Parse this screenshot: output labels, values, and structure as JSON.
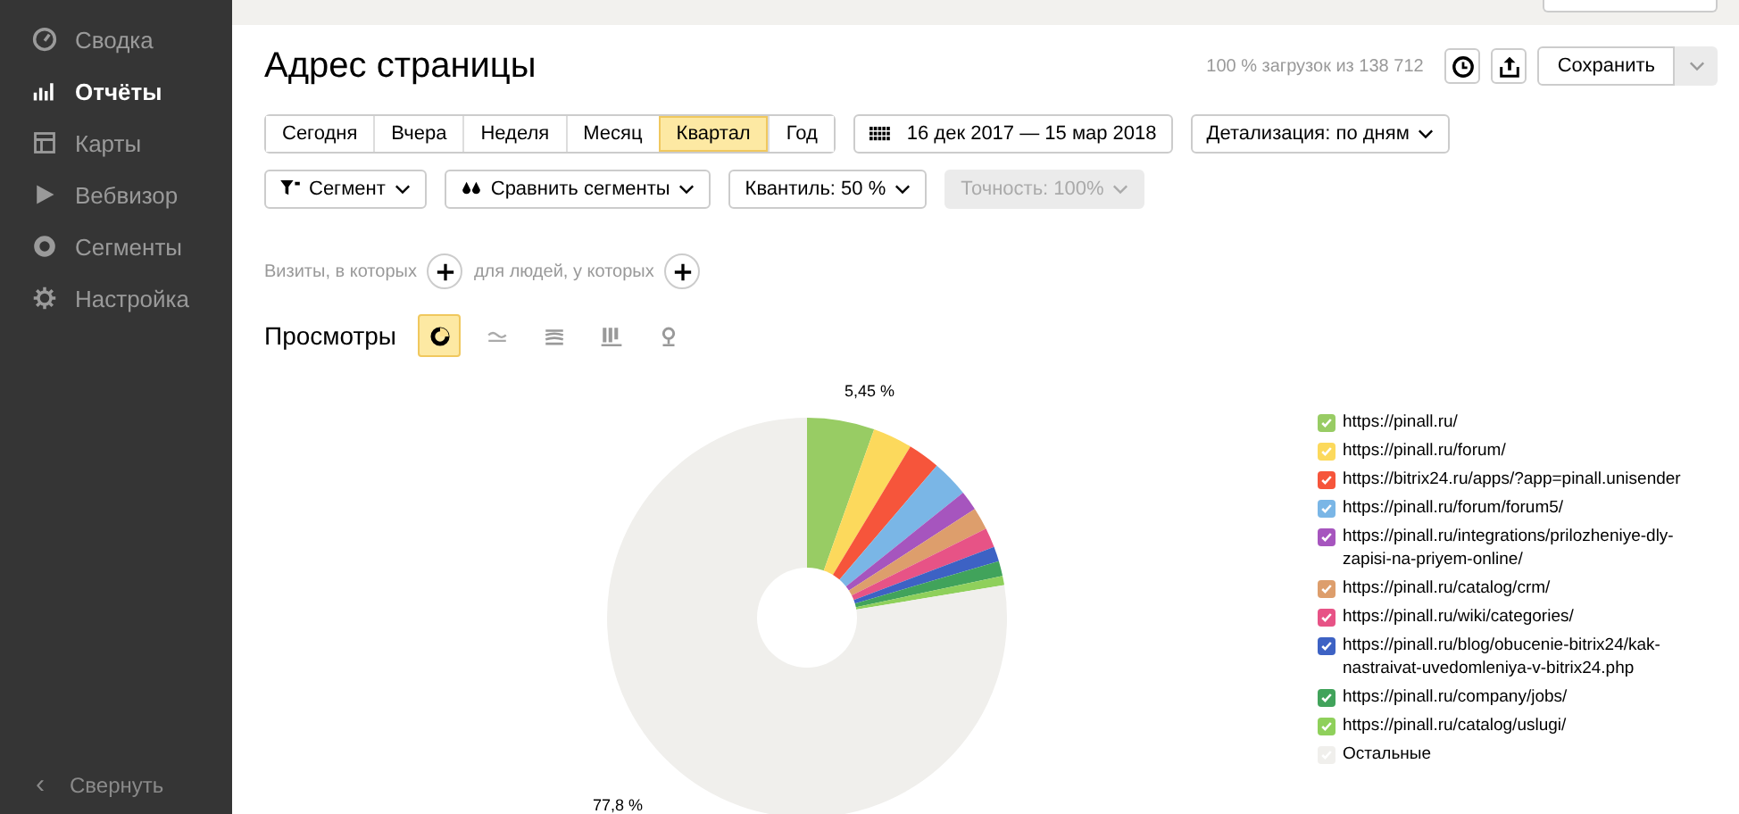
{
  "sidebar": {
    "items": [
      {
        "label": "Сводка",
        "selected": false
      },
      {
        "label": "Отчёты",
        "selected": true
      },
      {
        "label": "Карты",
        "selected": false
      },
      {
        "label": "Вебвизор",
        "selected": false
      },
      {
        "label": "Сегменты",
        "selected": false
      },
      {
        "label": "Настройка",
        "selected": false
      }
    ],
    "collapse": {
      "arrow": "‹",
      "label": "Свернуть"
    }
  },
  "header": {
    "title": "Адрес страницы",
    "load_info": "100 % загрузок из 138 712",
    "save_button": "Сохранить"
  },
  "periods": [
    {
      "label": "Сегодня",
      "selected": false
    },
    {
      "label": "Вчера",
      "selected": false
    },
    {
      "label": "Неделя",
      "selected": false
    },
    {
      "label": "Месяц",
      "selected": false
    },
    {
      "label": "Квартал",
      "selected": true
    },
    {
      "label": "Год",
      "selected": false
    }
  ],
  "date_range": "16 дек 2017 — 15 мар 2018",
  "detail": "Детализация: по дням",
  "filters": [
    {
      "label": "Сегмент",
      "disabled": false
    },
    {
      "label": "Сравнить сегменты",
      "disabled": false
    },
    {
      "label": "Квантиль: 50 %",
      "disabled": false
    },
    {
      "label": "Точность: 100%",
      "disabled": true
    }
  ],
  "conditions": {
    "visits": "Визиты, в которых",
    "people": "для людей, у которых"
  },
  "metric": {
    "label": "Просмотры",
    "chart_types": [
      {
        "selected": true
      },
      {
        "selected": false
      },
      {
        "selected": false
      },
      {
        "selected": false
      },
      {
        "selected": false
      }
    ]
  },
  "chart": {
    "top_label": "5,45 %",
    "bottom_label": "77,8 %"
  },
  "legend": [
    {
      "label": "https://pinall.ru/",
      "color": "#98cc64",
      "checked": true
    },
    {
      "label": "https://pinall.ru/forum/",
      "color": "#fcd95c",
      "checked": true
    },
    {
      "label": "https://bitrix24.ru/apps/?app=pinall.unisender",
      "color": "#f6553b",
      "checked": true
    },
    {
      "label": "https://pinall.ru/forum/forum5/",
      "color": "#7ab6e6",
      "checked": true
    },
    {
      "label": "https://pinall.ru/integrations/prilozheniye-dly-zapisi-na-priyem-online/",
      "color": "#a655be",
      "checked": true
    },
    {
      "label": "https://pinall.ru/catalog/crm/",
      "color": "#dd9e6c",
      "checked": true
    },
    {
      "label": "https://pinall.ru/wiki/categories/",
      "color": "#e75386",
      "checked": true
    },
    {
      "label": "https://pinall.ru/blog/obucenie-bitrix24/kak-nastraivat-uvedomleniya-v-bitrix24.php",
      "color": "#3d62c4",
      "checked": true
    },
    {
      "label": "https://pinall.ru/company/jobs/",
      "color": "#41a35b",
      "checked": true
    },
    {
      "label": "https://pinall.ru/catalog/uslugi/",
      "color": "#8fd05b",
      "checked": true
    },
    {
      "label": "Остальные",
      "color": "#f0efec",
      "checked": true
    }
  ]
}
